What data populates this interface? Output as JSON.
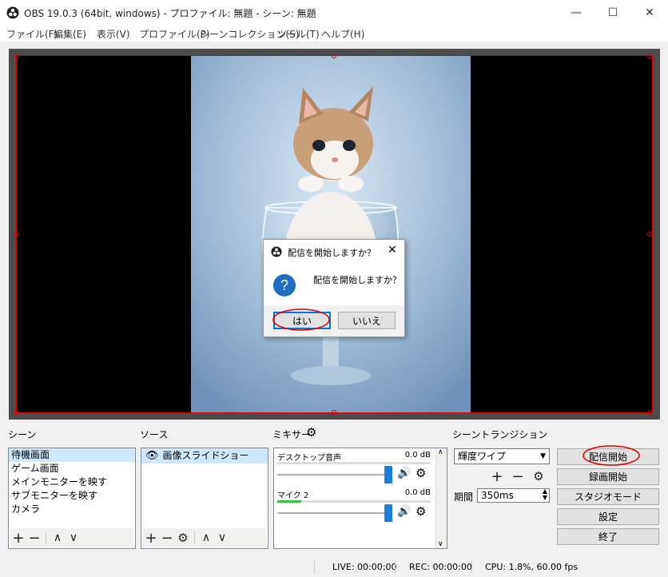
{
  "window": {
    "title": "OBS 19.0.3 (64bit, windows) - プロファイル: 無題 - シーン: 無題",
    "minimize": "—",
    "maximize": "☐",
    "close": "✕"
  },
  "menu": [
    "ファイル(F)",
    "編集(E)",
    "表示(V)",
    "プロファイル(P)",
    "シーンコレクション(S)",
    "ツール(T)",
    "ヘルプ(H)"
  ],
  "dialog": {
    "title": "配信を開始しますか？",
    "message": "配信を開始しますか？",
    "yes": "はい",
    "no": "いいえ"
  },
  "scenes": {
    "label": "シーン",
    "items": [
      "待機画面",
      "ゲーム画面",
      "メインモニターを映す",
      "サブモニターを映す",
      "カメラ"
    ]
  },
  "sources": {
    "label": "ソース",
    "items": [
      "画像スライドショー"
    ]
  },
  "mixer": {
    "label": "ミキサー",
    "channels": [
      {
        "name": "デスクトップ音声",
        "db": "0.0 dB",
        "volume": 1.0
      },
      {
        "name": "マイク 2",
        "db": "0.0 dB",
        "volume": 1.0
      }
    ]
  },
  "transitions": {
    "label": "シーントランジション",
    "selected": "輝度ワイプ",
    "duration_label": "期間",
    "duration_value": "350ms"
  },
  "controls": {
    "start_stream": "配信開始",
    "start_record": "録画開始",
    "studio_mode": "スタジオモード",
    "settings": "設定",
    "exit": "終了"
  },
  "status": {
    "live": "LIVE: 00:00:00",
    "rec": "REC: 00:00:00",
    "cpu": "CPU: 1.8%, 60.00 fps"
  },
  "colors": {
    "selection_outline": "#d40000",
    "annotation": "#e00000",
    "accent": "#1e7fd8"
  }
}
